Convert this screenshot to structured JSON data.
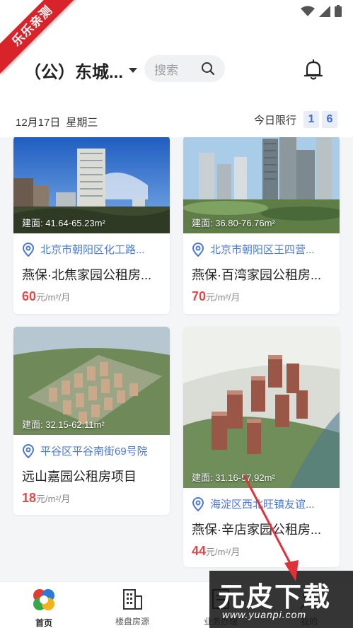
{
  "ribbon": "乐乐亲测",
  "header": {
    "city": "（公）东城...",
    "search_placeholder": "搜索"
  },
  "dateline": {
    "date": "12月17日",
    "weekday": "星期三",
    "limit_label": "今日限行",
    "limit_numbers": [
      "1",
      "6"
    ]
  },
  "listings": [
    {
      "area": "建面: 41.64-65.23m²",
      "address": "北京市朝阳区化工路...",
      "name": "燕保·北焦家园公租房...",
      "price": "60",
      "unit": "元/m²/月"
    },
    {
      "area": "建面: 36.80-76.76m²",
      "address": "北京市朝阳区王四营...",
      "name": "燕保·百湾家园公租房...",
      "price": "70",
      "unit": "元/m²/月"
    },
    {
      "area": "建面: 32.15-62.11m²",
      "address": "平谷区平谷南街69号院",
      "name": "远山嘉园公租房项目",
      "price": "18",
      "unit": "元/m²/月"
    },
    {
      "area": "建面: 31.16-57.92m²",
      "address": "海淀区西北旺镇友谊...",
      "name": "燕保·辛店家园公租房...",
      "price": "44",
      "unit": "元/m²/月"
    }
  ],
  "tabs": [
    {
      "label": "首页",
      "icon": "home-logo-icon"
    },
    {
      "label": "楼盘房源",
      "icon": "building-icon"
    },
    {
      "label": "业务办理",
      "icon": "form-icon"
    },
    {
      "label": "我的",
      "icon": "user-icon"
    }
  ],
  "watermark": {
    "title": "元皮下载",
    "url": "www.yuanpi.com"
  },
  "colors": {
    "accent": "#4a78d6",
    "price": "#e0484a",
    "ribbon": "#d9232a"
  }
}
